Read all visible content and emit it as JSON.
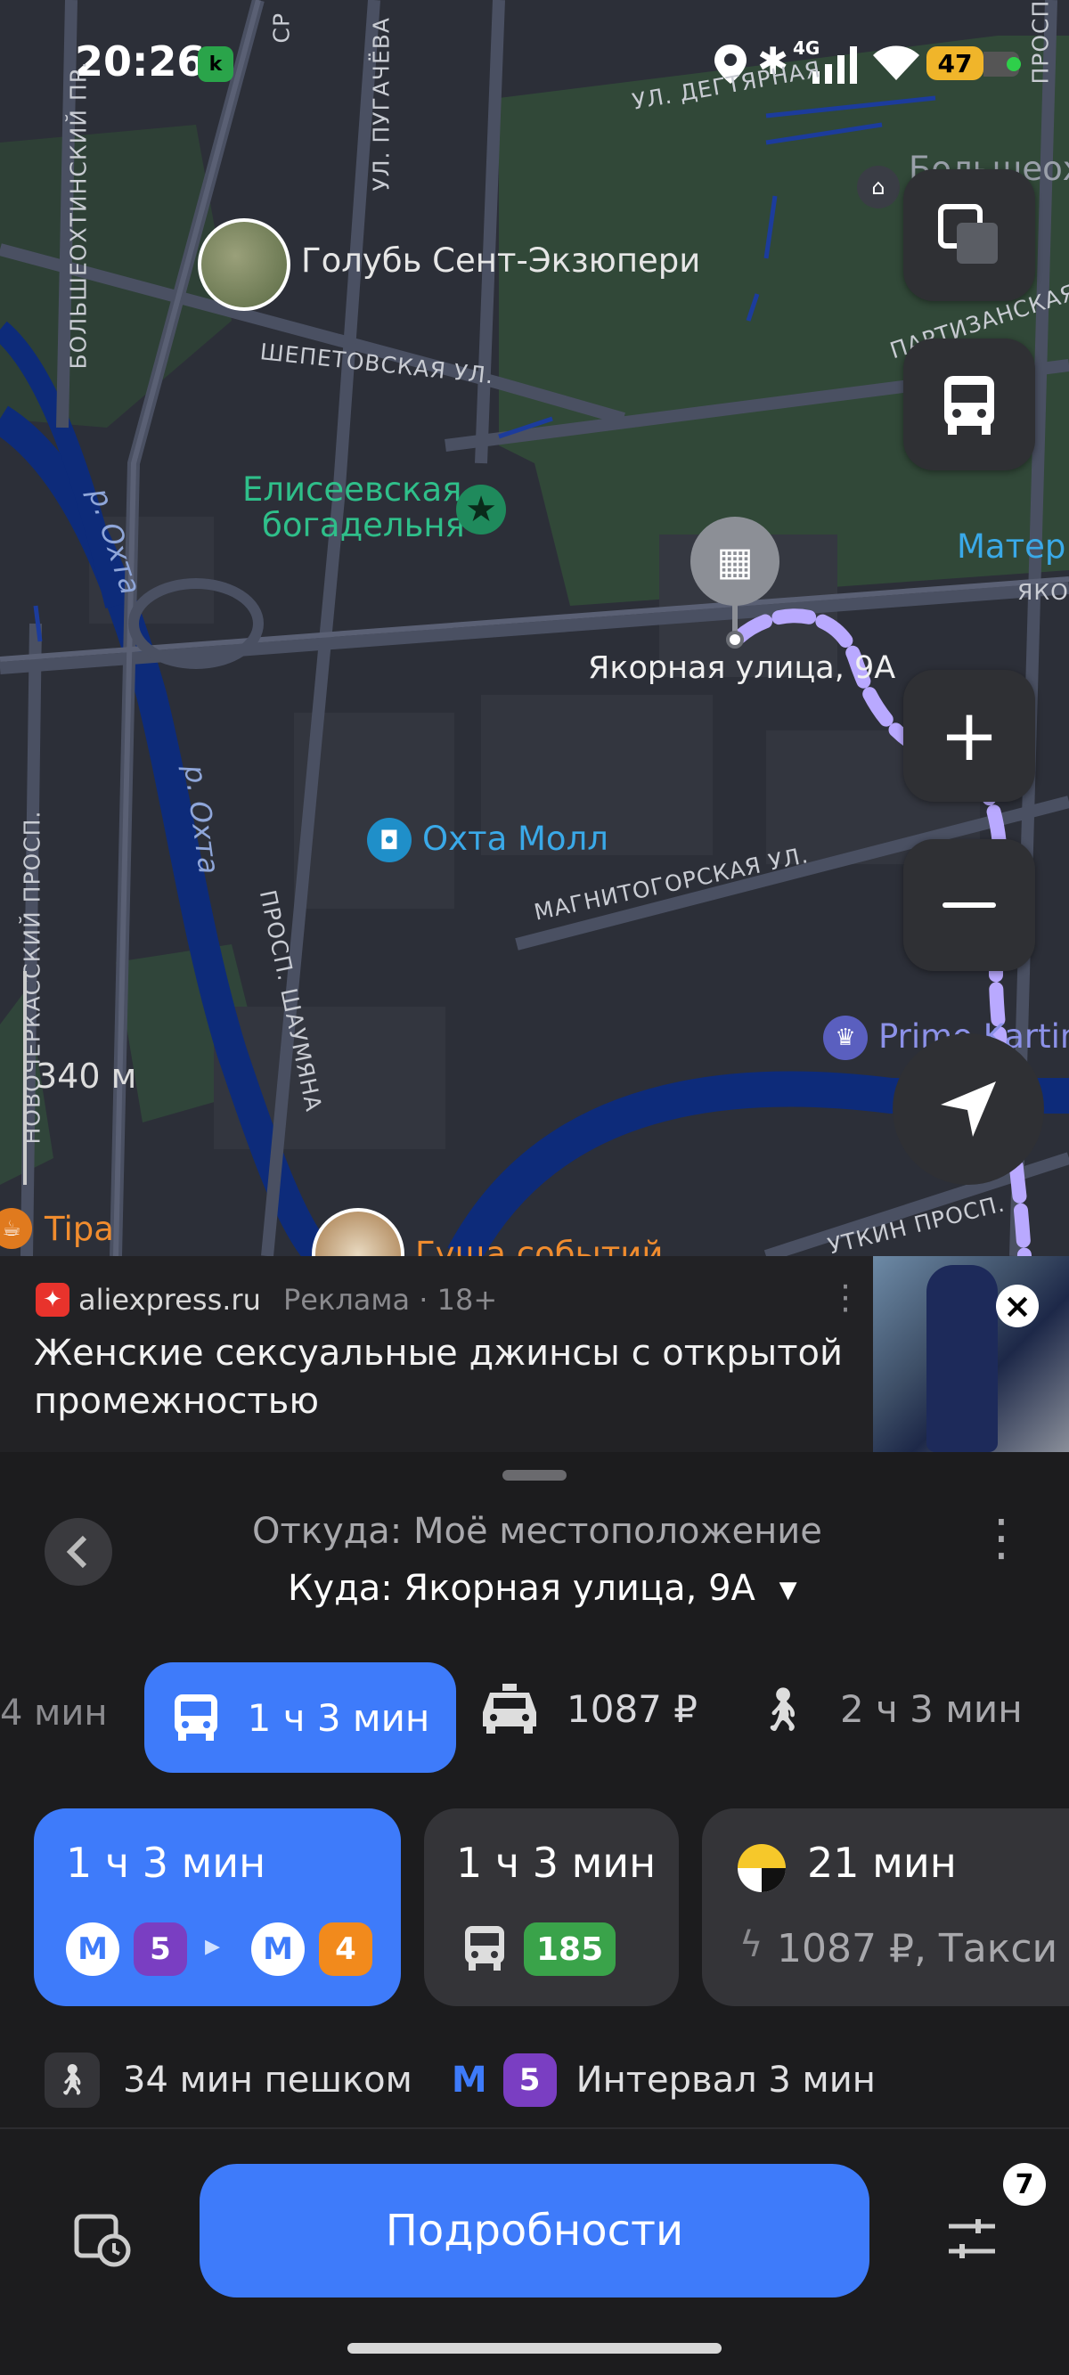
{
  "status": {
    "time": "20:26",
    "network": "4G",
    "battery": "47"
  },
  "map": {
    "streets": {
      "degtyarnaya": "УЛ. ДЕГТЯРНАЯ",
      "bolsheokhtinsky": "БОЛЬШЕОХТИНСКИЙ ПР.",
      "pugacheva": "УЛ. ПУГАЧЁВА",
      "shepetovskaya": "ШЕПЕТОВСКАЯ УЛ.",
      "partizanskaya": "ПАРТИЗАНСКАЯ",
      "magnitogorskaya": "МАГНИТОГОРСКАЯ УЛ.",
      "novocherkassky": "НОВОЧЕРКАССКИЙ ПРОСП.",
      "shaumyana": "ПРОСП. ШАУМЯНА",
      "utkin": "УТКИН ПРОСП.",
      "prosp_top": "ПРОСП",
      "yako": "ЯКО",
      "sr": "СР"
    },
    "rivers": {
      "okhta1": "р. Охта",
      "okhta2": "р. Охта"
    },
    "pois": {
      "golub": "Голубь Сент-Экзюпери",
      "eliseev1": "Елисеевская",
      "eliseev2": "богадельня",
      "okhta_mall": "Охта Молл",
      "destination": "Якорная улица, 9А",
      "bolsheokh": "Большеох",
      "mater": "Матер",
      "primo": "Primo Kartin",
      "tipa": "Tipa",
      "gusha": "Гуща событий"
    },
    "scale": "340 м"
  },
  "ad": {
    "domain": "aliexpress.ru",
    "meta": "Реклама · 18+",
    "line1": "Женские сексуальные джинсы с открытой",
    "line2": "промежностью"
  },
  "route": {
    "from": "Откуда: Моё местоположение",
    "to": "Куда: Якорная улица, 9А",
    "modes": {
      "prev": "4 мин",
      "transit": "1 ч 3 мин",
      "taxi": "1087 ₽",
      "walk": "2 ч 3 мин"
    },
    "options": [
      {
        "time": "1 ч 3 мин",
        "line1": "5",
        "line2": "4"
      },
      {
        "time": "1 ч 3 мин",
        "bus": "185"
      },
      {
        "time": "21 мин",
        "detail": "1087 ₽, Такси"
      }
    ],
    "summary": {
      "walk": "34 мин пешком",
      "metro_line": "5",
      "interval": "Интервал 3 мин"
    },
    "details_button": "Подробности",
    "filter_badge": "7"
  },
  "colors": {
    "accent": "#3e7bfa",
    "line5": "#7a3ec2",
    "line4": "#f28a1c",
    "bus_green": "#3aa34a",
    "route": "#b9a9ff"
  }
}
